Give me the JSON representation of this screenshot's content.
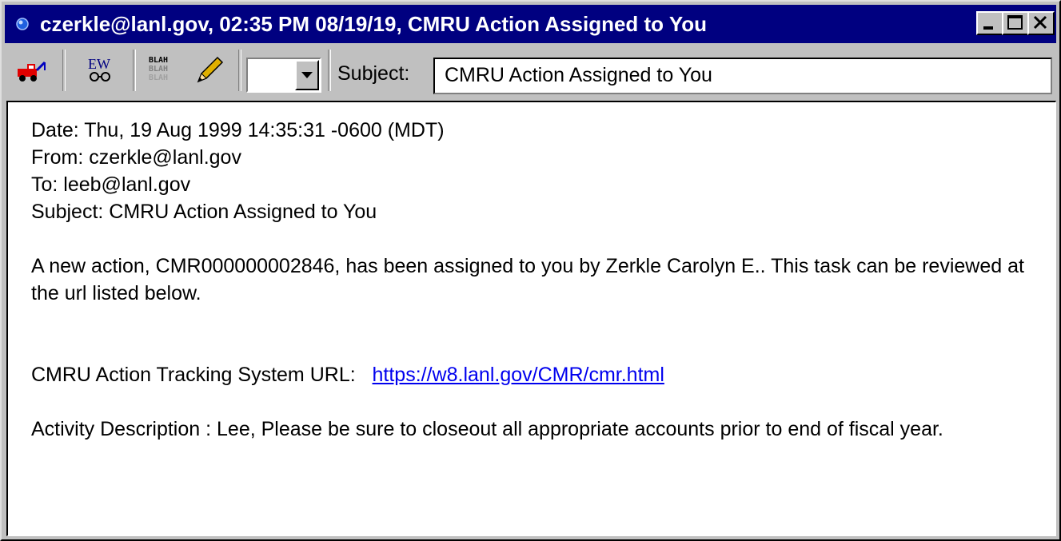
{
  "window": {
    "title": "czerkle@lanl.gov, 02:35 PM 08/19/19, CMRU Action Assigned to You"
  },
  "toolbar": {
    "combo_value": "",
    "subject_label": "Subject:",
    "subject_value": "CMRU Action Assigned to You"
  },
  "message": {
    "date_line": "Date: Thu, 19 Aug 1999 14:35:31 -0600 (MDT)",
    "from_line": "From: czerkle@lanl.gov",
    "to_line": "To: leeb@lanl.gov",
    "subject_line": "Subject: CMRU Action Assigned to You",
    "paragraph1": "A new action, CMR000000002846, has been assigned to you by Zerkle Carolyn E..  This task can be reviewed at the url listed below.",
    "url_label": "CMRU Action Tracking System URL:",
    "url": "https://w8.lanl.gov/CMR/cmr.html",
    "activity": "Activity Description : Lee,  Please be sure to closeout all appropriate accounts prior to end of fiscal year."
  },
  "icons": [
    "globe-icon",
    "tow-truck-icon",
    "ew-glasses-icon",
    "blah-icon",
    "pencil-icon",
    "dropdown-arrow-icon",
    "minimize-icon",
    "maximize-icon",
    "close-icon"
  ]
}
